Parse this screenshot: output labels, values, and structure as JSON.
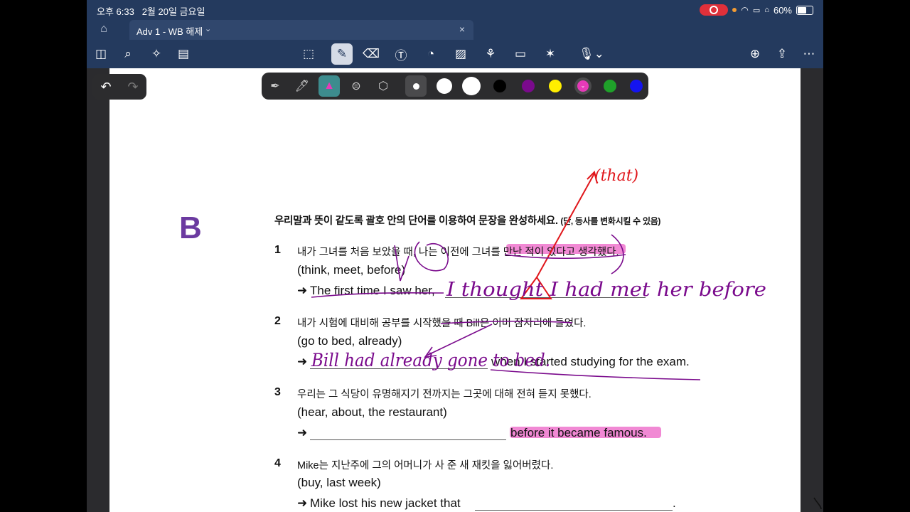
{
  "status_bar": {
    "time": "오후 6:33",
    "date": "2월 20일 금요일",
    "battery": "60%"
  },
  "tab": {
    "title": "Adv 1 - WB 해제",
    "close": "×"
  },
  "toolbar": {
    "left": [
      "sidebar-icon",
      "search-icon",
      "ai-sparkle-icon",
      "document-icon"
    ],
    "center": [
      "lasso-icon",
      "pen-icon",
      "eraser-icon",
      "text-box-icon",
      "shapes-icon",
      "image-icon",
      "elements-icon",
      "sticky-note-icon",
      "laser-pointer-icon",
      "microphone-icon"
    ],
    "right": [
      "add-page-icon",
      "share-icon",
      "more-icon"
    ],
    "active_tool": "pen"
  },
  "undo_redo": {
    "undo": "↶",
    "redo": "↷"
  },
  "pen_palette": {
    "tools": [
      "fountain-pen",
      "ball-pen",
      "highlighter",
      "tape",
      "shape-pen"
    ],
    "selected_tool": "highlighter",
    "colors": [
      "#ffffff",
      "#ffffff",
      "#ffffff",
      "#000000",
      "#7a0a8c",
      "#ffee00",
      "#e63ab8",
      "#1fa12a",
      "#1414f0"
    ],
    "selected_color": "#e63ab8"
  },
  "worksheet": {
    "section_letter": "B",
    "instruction": "우리말과 뜻이 같도록 괄호 안의 단어를 이용하여 문장을 완성하세요.",
    "instruction_note": "(단, 동사를 변화시킬 수 있음)",
    "arrow": "➜",
    "items": [
      {
        "number": "1",
        "korean": "내가 그녀를 처음 보았을 때, 나는 이전에 그녀를 만난 적이 있다고 생각했다.",
        "hint": "(think, meet, before)",
        "prefix": "The first time I saw her,",
        "suffix": ""
      },
      {
        "number": "2",
        "korean": "내가 시험에 대비해 공부를 시작했을 때 Bill은 이미 잠자리에 들었다.",
        "hint": "(go to bed, already)",
        "prefix": "",
        "suffix": "when I started studying for the exam."
      },
      {
        "number": "3",
        "korean": "우리는 그 식당이 유명해지기 전까지는 그곳에 대해 전혀 듣지 못했다.",
        "hint": "(hear, about, the restaurant)",
        "prefix": "",
        "suffix": "before it became famous."
      },
      {
        "number": "4",
        "korean": "Mike는 지난주에 그의 어머니가 사 준 새 재킷을 잃어버렸다.",
        "hint": "(buy, last week)",
        "prefix": "Mike lost his new jacket that",
        "suffix": "."
      }
    ]
  },
  "handwriting": {
    "note_that": "(that)",
    "answer1": "I thought I had met her before",
    "answer2": "Bill had already gone to bed."
  }
}
